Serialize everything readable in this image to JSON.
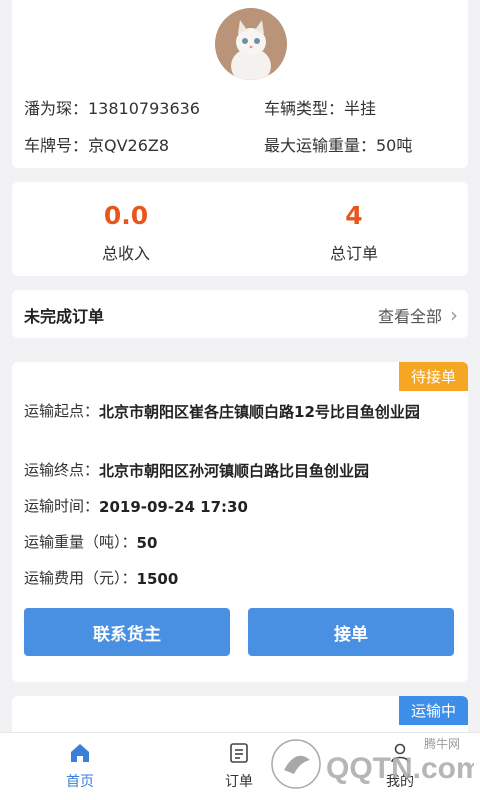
{
  "profile": {
    "name_phone": "潘为琛：13810793636",
    "vehicle_type": "车辆类型：半挂",
    "plate": "车牌号：京QV26Z8",
    "max_weight": "最大运输重量：50吨"
  },
  "stats": {
    "income_value": "0.0",
    "income_label": "总收入",
    "orders_value": "4",
    "orders_label": "总订单"
  },
  "pending": {
    "title": "未完成订单",
    "view_all": "查看全部"
  },
  "orders": [
    {
      "status": "待接单",
      "origin_label": "运输起点：",
      "origin": "北京市朝阳区崔各庄镇顺白路12号比目鱼创业园",
      "dest_label": "运输终点：",
      "dest": "北京市朝阳区孙河镇顺白路比目鱼创业园",
      "time_label": "运输时间：",
      "time": "2019-09-24 17:30",
      "weight_label": "运输重量（吨）：",
      "weight": "50",
      "fee_label": "运输费用（元）：",
      "fee": "1500",
      "contact_btn": "联系货主",
      "accept_btn": "接单"
    },
    {
      "status": "运输中"
    }
  ],
  "tabs": {
    "home": "首页",
    "orders": "订单",
    "mine": "我的"
  },
  "watermark": {
    "site": "腾牛网",
    "brand": "QQTN.com"
  },
  "colors": {
    "accent": "#e9561c",
    "primary": "#4a90e2",
    "badge_pending": "#f5a623",
    "badge_transit": "#3d8ee8",
    "tab_active": "#3b7fd8"
  }
}
